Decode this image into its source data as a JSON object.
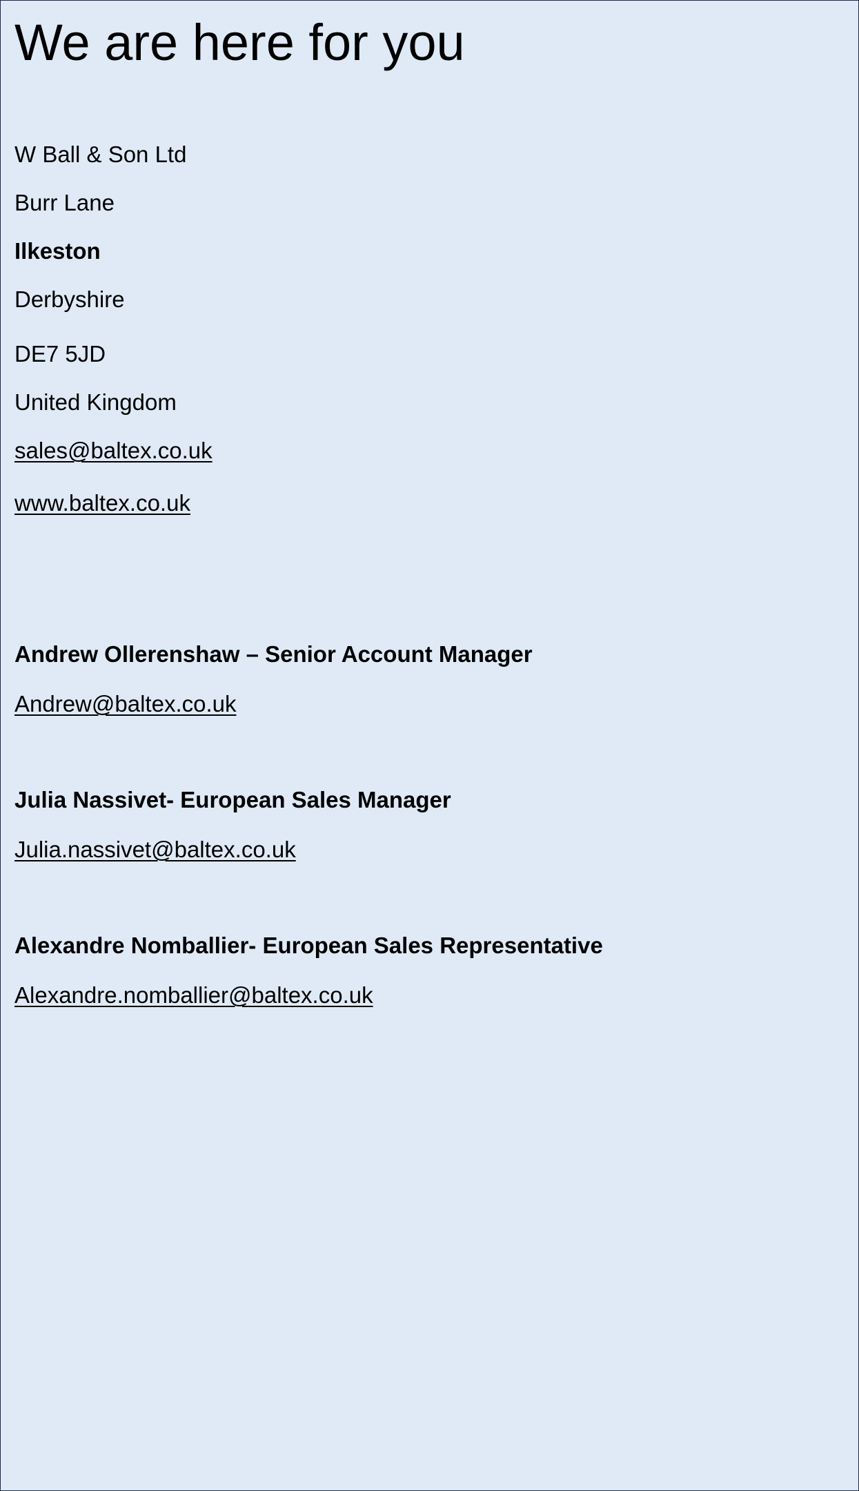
{
  "page": {
    "heading": "We are here for you",
    "colors": {
      "background": "#dfeaf6",
      "border": "#1f2a44",
      "text": "#000000"
    }
  },
  "address": {
    "company": "W Ball & Son Ltd",
    "street": "Burr Lane",
    "town": "Ilkeston",
    "county": "Derbyshire",
    "postcode": "DE7 5JD",
    "country": "United Kingdom",
    "email": "sales@baltex.co.uk",
    "website": "www.baltex.co.uk"
  },
  "contacts": [
    {
      "name_title": "Andrew Ollerenshaw – Senior Account Manager",
      "email": "Andrew@baltex.co.uk"
    },
    {
      "name_title": "Julia Nassivet- European Sales Manager",
      "email": "Julia.nassivet@baltex.co.uk"
    },
    {
      "name_title": "Alexandre Nomballier- European Sales Representative",
      "email": "Alexandre.nomballier@baltex.co.uk"
    }
  ]
}
